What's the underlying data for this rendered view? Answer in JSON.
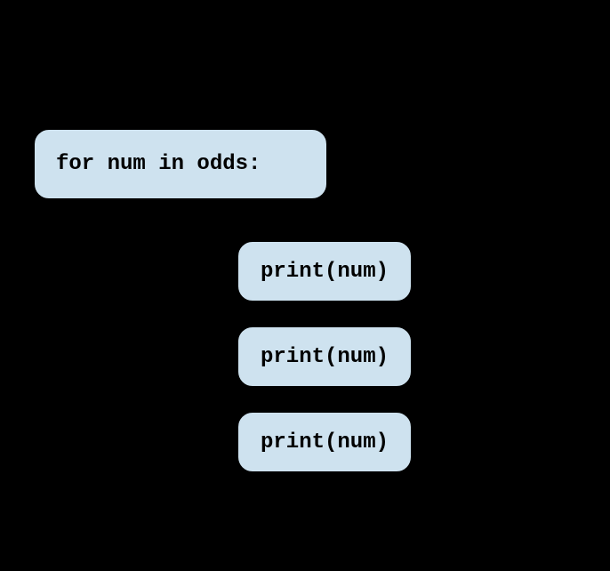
{
  "blocks": {
    "for_statement": "for num in odds:",
    "print_statement": "print(num)"
  }
}
